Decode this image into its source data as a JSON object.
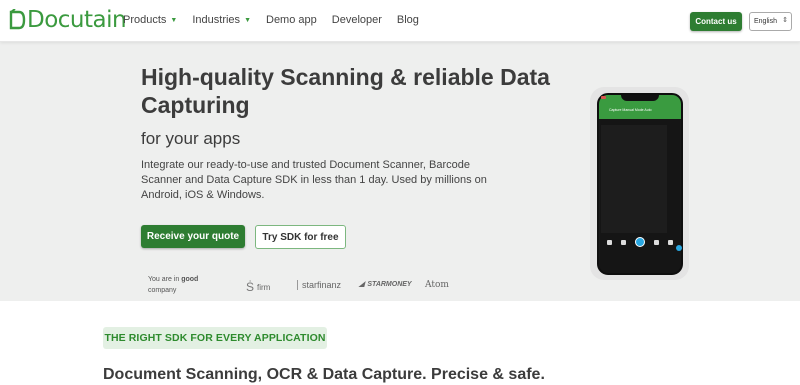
{
  "header": {
    "logo_text": "Docutain",
    "nav": [
      {
        "label": "Products",
        "has_caret": true
      },
      {
        "label": "Industries",
        "has_caret": true
      },
      {
        "label": "Demo app",
        "has_caret": false
      },
      {
        "label": "Developer",
        "has_caret": false
      },
      {
        "label": "Blog",
        "has_caret": false
      }
    ],
    "contact_label": "Contact us",
    "language": "English"
  },
  "hero": {
    "headline": "High-quality Scanning & reliable Data Capturing",
    "subheadline": "for your apps",
    "description": "Integrate our ready-to-use and trusted Document Scanner, Barcode Scanner and Data Capture SDK in less than 1 day. Used by millions on Android, iOS & Windows.",
    "primary_cta": "Receive your quote",
    "secondary_cta": "Try SDK for free",
    "company_prefix": "You are in",
    "company_bold": "good",
    "company_suffix": "company",
    "partners": {
      "firm": "firm",
      "starfinanz": "starfinanz",
      "starmoney": "STARMONEY",
      "atom": "Atom"
    },
    "phone_title": "Capture   Manual   Mode   Auto"
  },
  "section": {
    "badge": "THE RIGHT SDK FOR EVERY APPLICATION",
    "title": "Document Scanning, OCR & Data Capture. Precise & safe."
  },
  "colors": {
    "brand_green": "#2e7d32",
    "logo_green": "#3b9a3f",
    "hero_bg": "#eeefee",
    "accent_blue": "#29a7e1"
  }
}
